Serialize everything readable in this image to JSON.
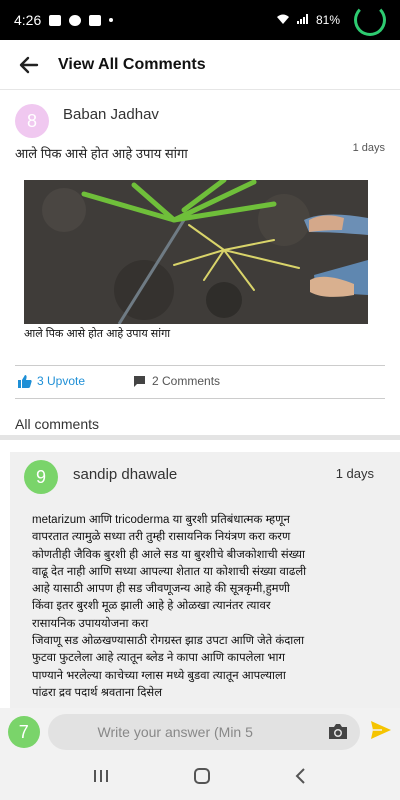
{
  "status_bar": {
    "time": "4:26",
    "battery": "81%"
  },
  "app_bar": {
    "title": "View All Comments",
    "back_icon": "arrow-left-icon"
  },
  "post": {
    "author_initial": "8",
    "author_name": "Baban Jadhav",
    "question": "आले पिक आसे होत आहे उपाय सांगा",
    "age": "1 days",
    "image_caption": "आले पिक आसे होत आहे उपाय सांगा",
    "upvote_label": "3 Upvote",
    "comments_label": "2 Comments"
  },
  "all_comments_label": "All comments",
  "comment": {
    "author_initial": "9",
    "author_name": "sandip dhawale",
    "age": "1 days",
    "lines": [
      "metarizum आणि tricoderma या बुरशी प्रतिबंधात्मक म्हणून",
      "वापरतात त्यामुळे सध्या तरी तुम्ही रासायनिक नियंत्रण करा करण",
      "कोणतीही जैविक बुरशी ही आले सड या बुरशीचे बीजकोशाची संख्या",
      "वाढू देत नाही आणि सध्या आपल्या शेतात या कोशाची संख्या वाढली",
      "आहे यासाठी आपण ही सड जीवणूजन्य आहे की सूत्रकृमी,हुमणी",
      "किंवा इतर बुरशी मूळ झाली आहे हे ओळखा त्यानंतर त्यावर",
      "रासायनिक उपाययोजना करा",
      "जिवाणू सड ओळखण्यासाठी रोगग्रस्त झाड उपटा आणि जेते कंदाला",
      "फुटवा फुटलेला आहे त्यातून ब्लेड ने कापा आणि कापलेला भाग",
      "पाण्याने भरलेल्या काचेच्या ग्लास मध्ये बुडवा त्यातून आपल्याला",
      "पांढरा द्रव पदार्थ श्रवताना दिसेल"
    ]
  },
  "composer": {
    "user_initial": "7",
    "placeholder": "Write your answer (Min 5"
  },
  "colors": {
    "upvote_blue": "#1e8fd6",
    "avatar_pink": "#f0c8f0",
    "avatar_green": "#7ad46a",
    "send_yellow": "#f5c400",
    "loader_green": "#2ecc71"
  }
}
